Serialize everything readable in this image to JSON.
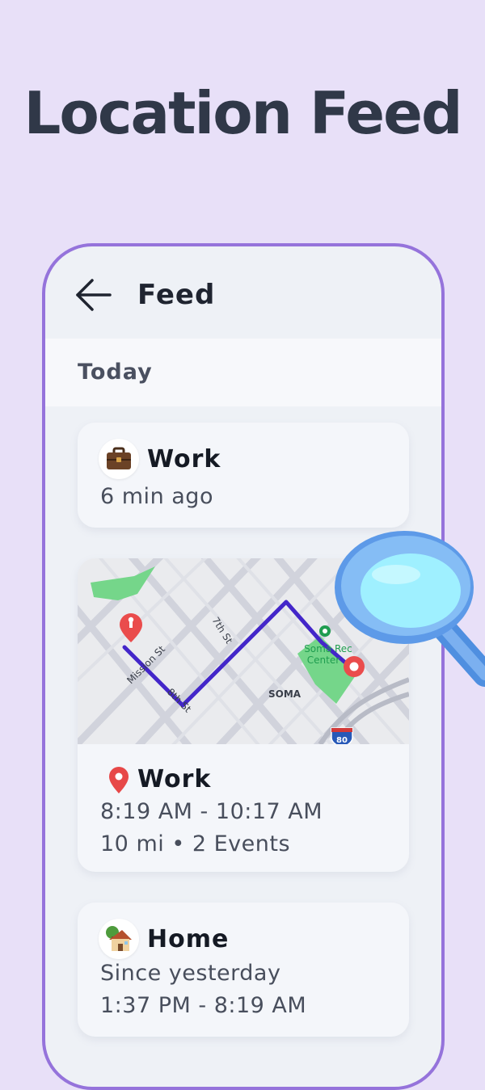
{
  "headline": "Location Feed",
  "appbar": {
    "title": "Feed",
    "back_icon": "arrow-left-icon"
  },
  "section": {
    "title": "Today"
  },
  "cards": [
    {
      "emoji": "💼",
      "title": "Work",
      "line1": "6 min ago"
    },
    {
      "map": {
        "streets": [
          "Mission St",
          "7th St",
          "8th St"
        ],
        "district": "SOMA",
        "poi_line1": "Soma Rec",
        "poi_line2": "Center",
        "highway_shield": "80",
        "route_color": "#4326c9",
        "pin_color": "#ea4c4c",
        "park_color": "#75d68a"
      },
      "emoji": "📍",
      "title": "Work",
      "line1": "8:19 AM - 10:17 AM",
      "line2": "10 mi • 2 Events"
    },
    {
      "emoji": "🏡",
      "title": "Home",
      "line1": "Since yesterday",
      "line2": "1:37 PM - 8:19 AM"
    }
  ],
  "colors": {
    "background": "#e8e0f8",
    "phone_border": "#9573db",
    "magnifier_glass": "#9ff0ff"
  }
}
